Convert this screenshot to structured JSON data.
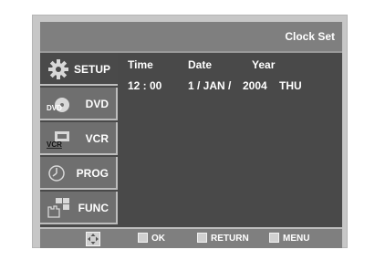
{
  "header": {
    "title": "Clock Set"
  },
  "sidebar": {
    "items": [
      {
        "label": "SETUP",
        "icon": "gear-icon",
        "active": true
      },
      {
        "label": "DVD",
        "icon": "dvd-disc-icon",
        "icon_text": "DVD",
        "active": false
      },
      {
        "label": "VCR",
        "icon": "vcr-cassette-icon",
        "icon_text": "VCR",
        "active": false
      },
      {
        "label": "PROG",
        "icon": "clock-icon",
        "active": false
      },
      {
        "label": "FUNC",
        "icon": "hand-function-icon",
        "active": false
      }
    ]
  },
  "clock": {
    "headers": {
      "time": "Time",
      "date": "Date",
      "year": "Year"
    },
    "values": {
      "time": "12 : 00",
      "date": "1 / JAN /",
      "year": "2004",
      "day": "THU"
    }
  },
  "footer": {
    "nav_icon": "dpad-icon",
    "ok": "OK",
    "return": "RETURN",
    "menu": "MENU"
  },
  "colors": {
    "screen_bg": "#494949",
    "bar_bg": "#7f7f7f",
    "bezel": "#c7c7c7"
  }
}
